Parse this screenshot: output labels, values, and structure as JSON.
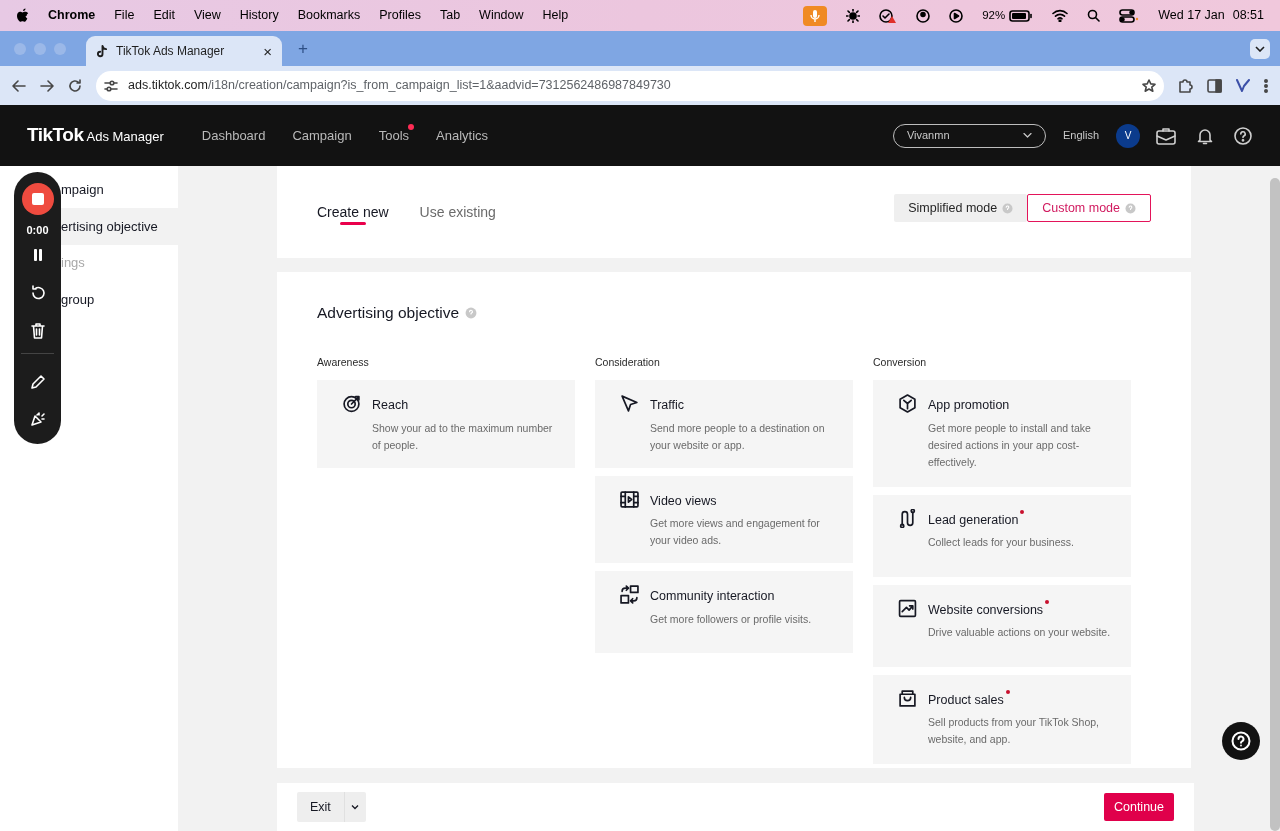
{
  "menu_bar": {
    "app": "Chrome",
    "items": [
      "File",
      "Edit",
      "View",
      "History",
      "Bookmarks",
      "Profiles",
      "Tab",
      "Window",
      "Help"
    ],
    "battery": "92%",
    "date": "Wed 17 Jan",
    "time": "08:51"
  },
  "browser": {
    "tab_title": "TikTok Ads Manager",
    "tab_close": "×",
    "new_tab": "+",
    "url_host": "ads.tiktok.com",
    "url_path": "/i18n/creation/campaign?is_from_campaign_list=1&aadvid=7312562486987849730"
  },
  "header": {
    "logo": "TikTok",
    "logo_suffix": "Ads Manager",
    "nav": [
      {
        "label": "Dashboard",
        "dot": false
      },
      {
        "label": "Campaign",
        "dot": false
      },
      {
        "label": "Tools",
        "dot": true
      },
      {
        "label": "Analytics",
        "dot": false
      }
    ],
    "account": "Vivanmn",
    "language": "English",
    "avatar": "V"
  },
  "sidebar": {
    "items": [
      {
        "label": "mpaign",
        "selected": false,
        "disabled": false
      },
      {
        "label": "ertising objective",
        "selected": true,
        "disabled": false
      },
      {
        "label": "ings",
        "selected": false,
        "disabled": true
      },
      {
        "label": "group",
        "selected": false,
        "disabled": false
      }
    ]
  },
  "recorder": {
    "timer": "0:00"
  },
  "tabs": [
    {
      "label": "Create new",
      "selected": true
    },
    {
      "label": "Use existing",
      "selected": false
    }
  ],
  "modes": [
    {
      "label": "Simplified mode",
      "selected": false
    },
    {
      "label": "Custom mode",
      "selected": true
    }
  ],
  "objective": {
    "title": "Advertising objective",
    "groups": [
      {
        "label": "Awareness",
        "items": [
          {
            "title": "Reach",
            "description": "Show your ad to the maximum number of people.",
            "dot": false
          }
        ]
      },
      {
        "label": "Consideration",
        "items": [
          {
            "title": "Traffic",
            "description": "Send more people to a destination on your website or app.",
            "dot": false
          },
          {
            "title": "Video views",
            "description": "Get more views and engagement for your video ads.",
            "dot": false
          },
          {
            "title": "Community interaction",
            "description": "Get more followers or profile visits.",
            "dot": false
          }
        ]
      },
      {
        "label": "Conversion",
        "items": [
          {
            "title": "App promotion",
            "description": "Get more people to install and take desired actions in your app cost-effectively.",
            "dot": false
          },
          {
            "title": "Lead generation",
            "description": "Collect leads for your business.",
            "dot": true
          },
          {
            "title": "Website conversions",
            "description": "Drive valuable actions on your website.",
            "dot": true
          },
          {
            "title": "Product sales",
            "description": "Sell products from your TikTok Shop, website, and app.",
            "dot": true
          }
        ]
      }
    ]
  },
  "footer": {
    "exit": "Exit",
    "continue": "Continue"
  }
}
